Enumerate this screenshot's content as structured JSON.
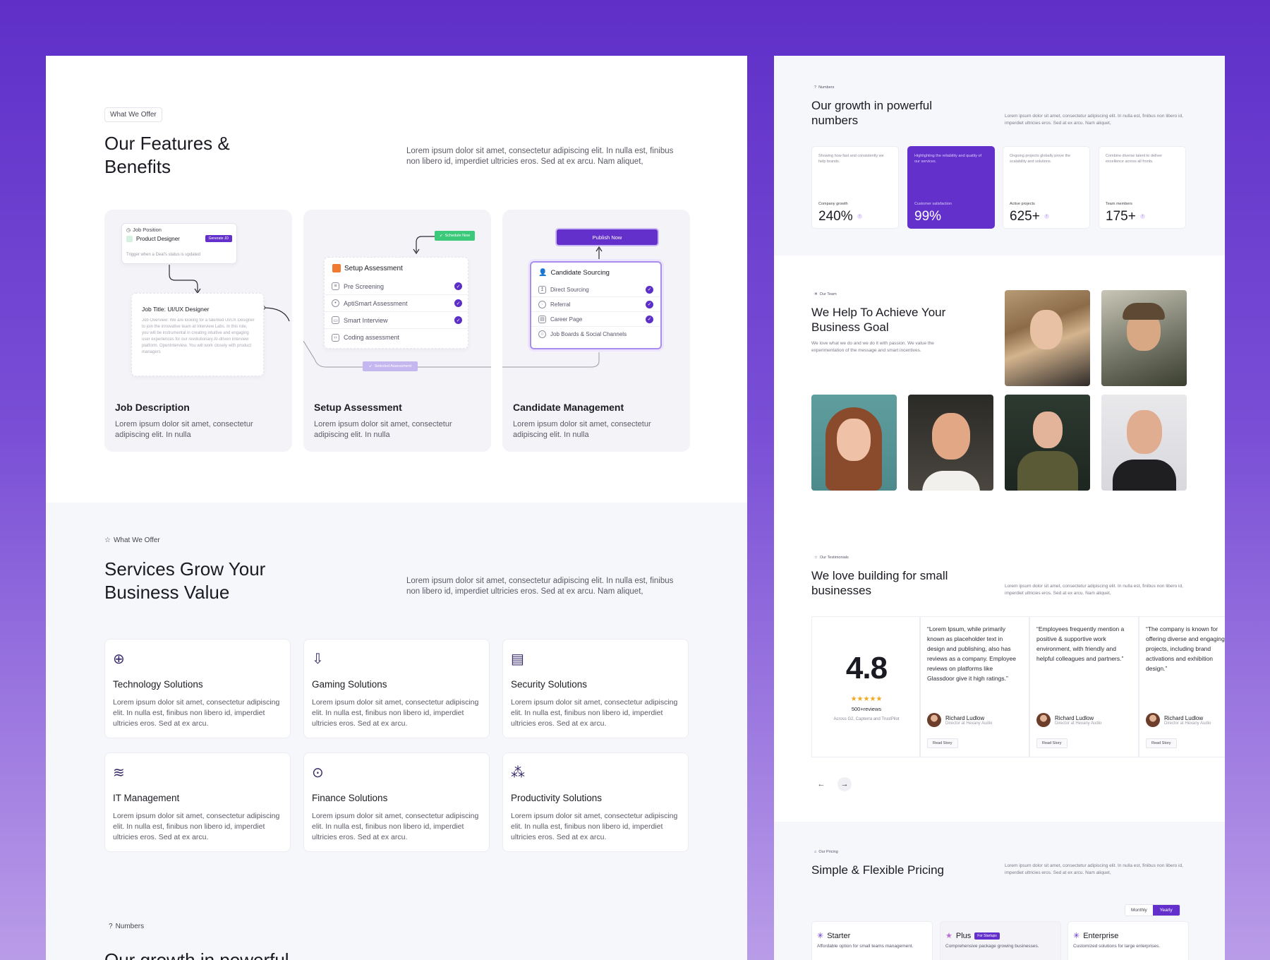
{
  "features": {
    "pill": "What We Offer",
    "title_line1": "Our Features &",
    "title_line2": "Benefits",
    "lead": "Lorem ipsum dolor sit amet, consectetur adipiscing elit. In nulla est, finibus non libero id, imperdiet ultricies eros. Sed at ex arcu. Nam aliquet,",
    "cards": [
      {
        "title": "Job Description",
        "desc": "Lorem ipsum dolor sit amet, consectetur adipiscing elit. In nulla"
      },
      {
        "title": "Setup Assessment",
        "desc": "Lorem ipsum dolor sit amet, consectetur adipiscing elit. In nulla"
      },
      {
        "title": "Candidate Management",
        "desc": "Lorem ipsum dolor sit amet, consectetur adipiscing elit. In nulla"
      }
    ],
    "job": {
      "position_label": "Job Position",
      "position_value": "Product Designer",
      "generate_btn": "Generate JD",
      "trigger": "Trigger when a Deal's status is updated",
      "title": "Job Title: UI/UX Designer",
      "overview": "Job Overview: We are looking for a talented UI/UX Designer to join the innovative team at Interview Labs. In this role, you will be instrumental in creating intuitive and engaging user experiences for our revolutionary AI-driven interview platform. OpenInterview. You will work closely with product managers"
    },
    "assessment": {
      "schedule_btn": "Schedule Now",
      "title": "Setup Assessment",
      "items": [
        "Pre Screening",
        "AptiSmart Assessment",
        "Smart Interview",
        "Coding assessment"
      ],
      "selected_btn": "Selected Assessment"
    },
    "candidate": {
      "publish_btn": "Publish Now",
      "title": "Candidate Sourcing",
      "items": [
        "Direct Sourcing",
        "Referral",
        "Career Page",
        "Job Boards & Social Channels"
      ]
    }
  },
  "services": {
    "pill": "What We Offer",
    "title_line1": "Services Grow Your",
    "title_line2": "Business Value",
    "lead": "Lorem ipsum dolor sit amet, consectetur adipiscing elit. In nulla est, finibus non libero id, imperdiet ultricies eros. Sed at ex arcu. Nam aliquet,",
    "items": [
      {
        "title": "Technology Solutions",
        "desc": "Lorem ipsum dolor sit amet, consectetur adipiscing elit. In nulla est, finibus non libero id, imperdiet ultricies eros. Sed at ex arcu."
      },
      {
        "title": "Gaming Solutions",
        "desc": "Lorem ipsum dolor sit amet, consectetur adipiscing elit. In nulla est, finibus non libero id, imperdiet ultricies eros. Sed at ex arcu."
      },
      {
        "title": "Security Solutions",
        "desc": "Lorem ipsum dolor sit amet, consectetur adipiscing elit. In nulla est, finibus non libero id, imperdiet ultricies eros. Sed at ex arcu."
      },
      {
        "title": "IT Management",
        "desc": "Lorem ipsum dolor sit amet, consectetur adipiscing elit. In nulla est, finibus non libero id, imperdiet ultricies eros. Sed at ex arcu."
      },
      {
        "title": "Finance Solutions",
        "desc": "Lorem ipsum dolor sit amet, consectetur adipiscing elit. In nulla est, finibus non libero id, imperdiet ultricies eros. Sed at ex arcu."
      },
      {
        "title": "Productivity Solutions",
        "desc": "Lorem ipsum dolor sit amet, consectetur adipiscing elit. In nulla est, finibus non libero id, imperdiet ultricies eros. Sed at ex arcu."
      }
    ],
    "numbers_pill": "Numbers",
    "numbers_peek": "Our growth in powerful"
  },
  "numbers": {
    "pill": "Numbers",
    "title_line1": "Our growth in powerful",
    "title_line2": "numbers",
    "lead": "Lorem ipsum dolor sit amet, consectetur adipiscing elit. In nulla est, finibus non libero id, imperdiet ultricies eros. Sed at ex arcu. Nam aliquet,",
    "stats": [
      {
        "desc": "Showing how fast and consistently we help brands.",
        "label": "Company growth",
        "value": "240%"
      },
      {
        "desc": "Highlighting the reliability and quality of our services.",
        "label": "Customer satisfaction",
        "value": "99%"
      },
      {
        "desc": "Ongoing projects globally prove the scalability and solutions.",
        "label": "Active projects",
        "value": "625+"
      },
      {
        "desc": "Combine diverse talent to deliver excellence across all fronts.",
        "label": "Team members",
        "value": "175+"
      }
    ]
  },
  "team": {
    "pill": "Our Team",
    "title_line1": "We Help To Achieve Your",
    "title_line2": "Business Goal",
    "lead": "We love what we do and we do it with passion. We value the experimentation of the message and smart incentives."
  },
  "testimonials": {
    "pill": "Our Testimonials",
    "title_line1": "We love building for small",
    "title_line2": "businesses",
    "lead": "Lorem ipsum dolor sit amet, consectetur adipiscing elit. In nulla est, finibus non libero id, imperdiet ultricies eros. Sed at ex arcu. Nam aliquet,",
    "rating": "4.8",
    "stars": "★★★★★",
    "reviews": "500+reviews",
    "sources": "Across G2, Capterra and TrustPilot",
    "items": [
      {
        "quote": "“Lorem Ipsum, while primarily known as placeholder text in design and publishing, also has reviews as a company. Employee reviews on platforms like Glassdoor give it high ratings.”",
        "name": "Richard Ludlow",
        "role": "Director at Hexany Audio",
        "btn": "Read Story"
      },
      {
        "quote": "“Employees frequently mention a positive & supportive work environment, with friendly and helpful colleagues and partners.”",
        "name": "Richard Ludlow",
        "role": "Director at Hexany Audio",
        "btn": "Read Story"
      },
      {
        "quote": "“The company is known for offering diverse and engaging projects, including brand activations and exhibition design.”",
        "name": "Richard Ludlow",
        "role": "Director at Hexany Audio",
        "btn": "Read Story"
      }
    ],
    "prev": "←",
    "next": "→"
  },
  "pricing": {
    "pill": "Our Pricing",
    "title": "Simple & Flexible Pricing",
    "lead": "Lorem ipsum dolor sit amet, consectetur adipiscing elit. In nulla est, finibus non libero id, imperdiet ultricies eros. Sed at ex arcu. Nam aliquet,",
    "toggle_monthly": "Monthly",
    "toggle_yearly": "Yearly",
    "plans": [
      {
        "name": "Starter",
        "badge": "",
        "desc": "Affordable option for small teams management."
      },
      {
        "name": "Plus",
        "badge": "For Startups",
        "desc": "Comprehensive package growing businesses."
      },
      {
        "name": "Enterprise",
        "badge": "",
        "desc": "Customized solutions for large enterprises."
      }
    ]
  },
  "colors": {
    "accent": "#6430cc",
    "background_top": "#5f2fc8",
    "background_bottom": "#b99ce8"
  }
}
